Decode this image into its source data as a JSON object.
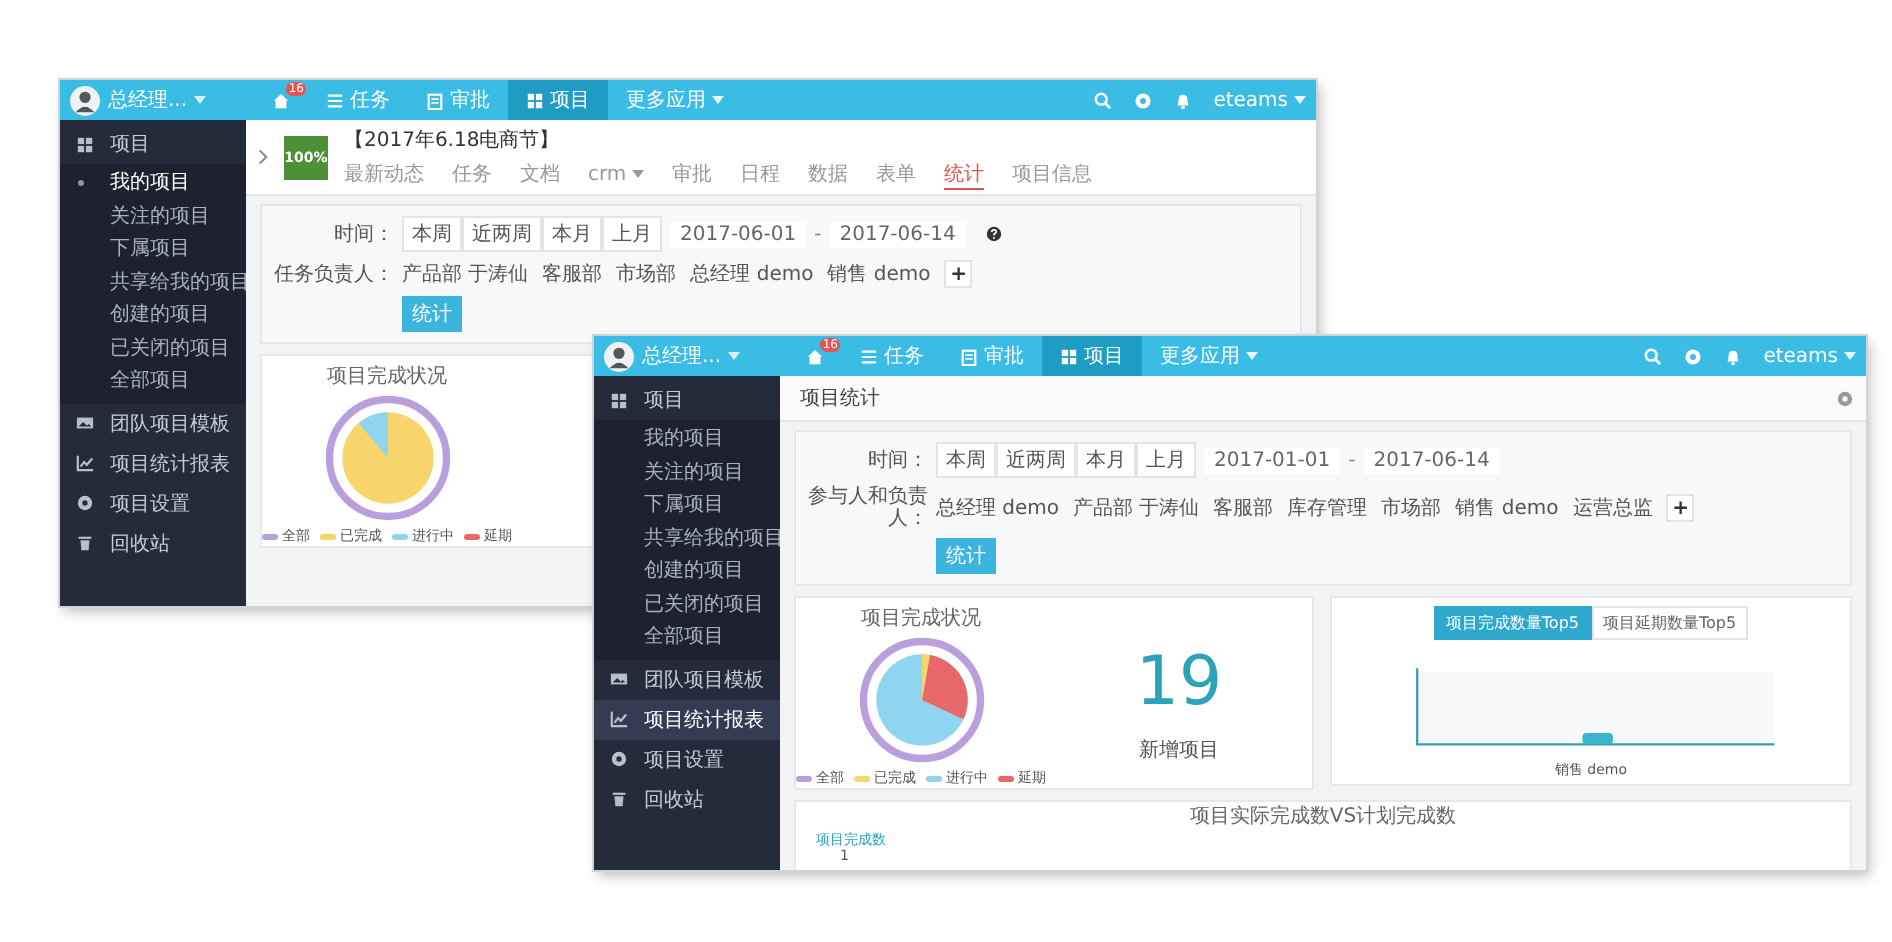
{
  "windows": [
    {
      "kind": "project",
      "topbar": {
        "user": "总经理...",
        "account": "eteams",
        "nav": [
          {
            "kind": "home",
            "badge": "16",
            "selected": false
          },
          {
            "kind": "tasks",
            "label": "任务",
            "selected": false
          },
          {
            "kind": "approval",
            "label": "审批",
            "selected": false
          },
          {
            "kind": "projects",
            "label": "项目",
            "selected": true
          },
          {
            "kind": "more",
            "label": "更多应用",
            "selected": false
          }
        ]
      },
      "sidebar": [
        {
          "kind": "projects",
          "label": "项目",
          "expanded": true,
          "selected": false,
          "children": [
            {
              "label": "我的项目",
              "selected": true
            },
            {
              "label": "关注的项目",
              "selected": false
            },
            {
              "label": "下属项目",
              "selected": false
            },
            {
              "label": "共享给我的项目",
              "selected": false
            },
            {
              "label": "创建的项目",
              "selected": false
            },
            {
              "label": "已关闭的项目",
              "selected": false
            },
            {
              "label": "全部项目",
              "selected": false
            }
          ]
        },
        {
          "kind": "templates",
          "label": "团队项目模板",
          "selected": false
        },
        {
          "kind": "reports",
          "label": "项目统计报表",
          "selected": false
        },
        {
          "kind": "settings",
          "label": "项目设置",
          "selected": false
        },
        {
          "kind": "trash",
          "label": "回收站",
          "selected": false
        }
      ],
      "project": {
        "progress": "100%",
        "title": "【2017年6.18电商节】",
        "tabs": [
          {
            "label": "最新动态",
            "selected": false
          },
          {
            "label": "任务",
            "selected": false
          },
          {
            "label": "文档",
            "selected": false
          },
          {
            "label": "crm",
            "dropdown": true,
            "selected": false
          },
          {
            "label": "审批",
            "selected": false
          },
          {
            "label": "日程",
            "selected": false
          },
          {
            "label": "数据",
            "selected": false
          },
          {
            "label": "表单",
            "selected": false
          },
          {
            "label": "统计",
            "selected": true
          },
          {
            "label": "项目信息",
            "selected": false
          }
        ]
      },
      "filter": {
        "time_label": "时间：",
        "periods": [
          "本周",
          "近两周",
          "本月",
          "上月"
        ],
        "date_from": "2017-06-01",
        "separator": "-",
        "date_to": "2017-06-14",
        "help": true,
        "people_label": "任务负责人：",
        "people": [
          "产品部 于涛仙",
          "客服部",
          "市场部",
          "总经理 demo",
          "销售 demo"
        ],
        "add": "+",
        "submit": "统计"
      },
      "pie_card": {
        "title": "项目完成状况",
        "legend": [
          {
            "label": "全部",
            "color": "#b9a0dc"
          },
          {
            "label": "已完成",
            "color": "#f7d56b"
          },
          {
            "label": "进行中",
            "color": "#8fd5f0"
          },
          {
            "label": "延期",
            "color": "#e8686a"
          }
        ]
      }
    },
    {
      "kind": "report",
      "topbar": {
        "user": "总经理...",
        "account": "eteams",
        "nav": [
          {
            "kind": "home",
            "badge": "16",
            "selected": false
          },
          {
            "kind": "tasks",
            "label": "任务",
            "selected": false
          },
          {
            "kind": "approval",
            "label": "审批",
            "selected": false
          },
          {
            "kind": "projects",
            "label": "项目",
            "selected": true
          },
          {
            "kind": "more",
            "label": "更多应用",
            "selected": false
          }
        ]
      },
      "sidebar": [
        {
          "kind": "projects",
          "label": "项目",
          "expanded": true,
          "selected": false,
          "children": [
            {
              "label": "我的项目",
              "selected": false
            },
            {
              "label": "关注的项目",
              "selected": false
            },
            {
              "label": "下属项目",
              "selected": false
            },
            {
              "label": "共享给我的项目",
              "selected": false
            },
            {
              "label": "创建的项目",
              "selected": false
            },
            {
              "label": "已关闭的项目",
              "selected": false
            },
            {
              "label": "全部项目",
              "selected": false
            }
          ]
        },
        {
          "kind": "templates",
          "label": "团队项目模板",
          "selected": false
        },
        {
          "kind": "reports",
          "label": "项目统计报表",
          "selected": true
        },
        {
          "kind": "settings",
          "label": "项目设置",
          "selected": false
        },
        {
          "kind": "trash",
          "label": "回收站",
          "selected": false
        }
      ],
      "page_title": "项目统计",
      "filter": {
        "time_label": "时间：",
        "periods": [
          "本周",
          "近两周",
          "本月",
          "上月"
        ],
        "date_from": "2017-01-01",
        "separator": "-",
        "date_to": "2017-06-14",
        "help": false,
        "people_label": "参与人和负责人：",
        "people": [
          "总经理 demo",
          "产品部 于涛仙",
          "客服部",
          "库存管理",
          "市场部",
          "销售 demo",
          "运营总监"
        ],
        "add": "+",
        "submit": "统计"
      },
      "pie_card": {
        "title": "项目完成状况",
        "legend": [
          {
            "label": "全部",
            "color": "#b9a0dc"
          },
          {
            "label": "已完成",
            "color": "#f7d56b"
          },
          {
            "label": "进行中",
            "color": "#8fd5f0"
          },
          {
            "label": "延期",
            "color": "#e8686a"
          }
        ]
      },
      "count_card": {
        "value": "19",
        "label": "新增项目"
      },
      "top_card": {
        "tabs": [
          {
            "label": "项目完成数量Top5",
            "selected": true
          },
          {
            "label": "项目延期数量Top5",
            "selected": false
          }
        ],
        "category": "销售 demo"
      },
      "compare_card": {
        "title": "项目实际完成数VS计划完成数",
        "ylabel": "项目完成数",
        "tick": "1"
      }
    }
  ]
}
